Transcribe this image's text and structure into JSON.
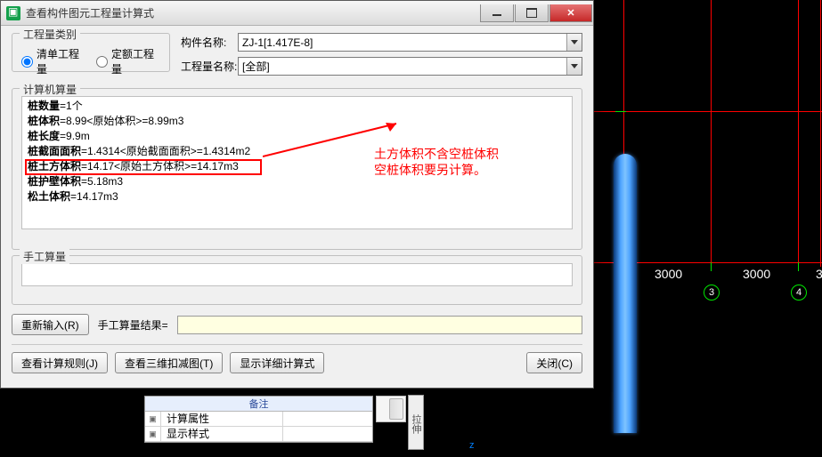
{
  "window": {
    "title": "查看构件图元工程量计算式"
  },
  "type_group": {
    "legend": "工程量类别",
    "bill": "清单工程量",
    "quota": "定额工程量"
  },
  "component_name": {
    "label": "构件名称:",
    "value": "ZJ-1[1.417E-8]"
  },
  "quantity_name": {
    "label": "工程量名称:",
    "value": "[全部]"
  },
  "calc": {
    "legend": "计算机算量",
    "lines": [
      {
        "b": "桩数量",
        "rest": "=1个"
      },
      {
        "b": "桩体积",
        "rest": "=8.99<原始体积>=8.99m3"
      },
      {
        "b": "桩长度",
        "rest": "=9.9m"
      },
      {
        "b": "桩截面面积",
        "rest": "=1.4314<原始截面面积>=1.4314m2"
      },
      {
        "b": "桩土方体积",
        "rest": "=14.17<原始土方体积>=14.17m3"
      },
      {
        "b": "桩护壁体积",
        "rest": "=5.18m3"
      },
      {
        "b": "松土体积",
        "rest": "=14.17m3"
      }
    ]
  },
  "annotation": {
    "line1": "土方体积不含空桩体积",
    "line2": "空桩体积要另计算。"
  },
  "manual": {
    "legend": "手工算量"
  },
  "buttons": {
    "reinput": "重新输入(R)",
    "manual_result_label": "手工算量结果=",
    "view_rule": "查看计算规则(J)",
    "view_3d": "查看三维扣减图(T)",
    "show_detail": "显示详细计算式",
    "close": "关闭(C)"
  },
  "propgrid": {
    "header": "备注",
    "rows": [
      "计算属性",
      "显示样式"
    ]
  },
  "sidebar_label": "拉伸",
  "viewport": {
    "dims": [
      "3000",
      "3000"
    ],
    "nodes": [
      "3",
      "4"
    ],
    "axis": "z"
  }
}
